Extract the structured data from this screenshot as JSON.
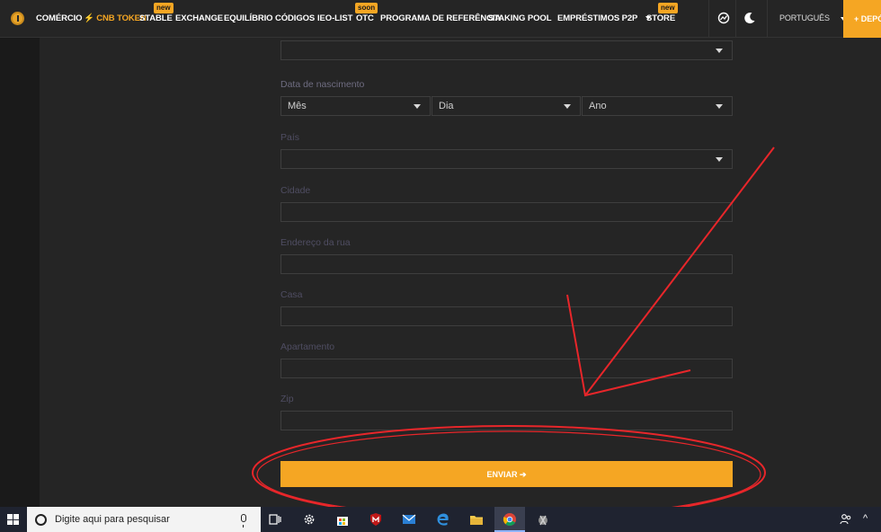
{
  "nav": {
    "items": [
      {
        "label": "COMÉRCIO"
      },
      {
        "label": "⚡ CNB TOKEN"
      },
      {
        "label": "STABLE",
        "badge": "new"
      },
      {
        "label": "EXCHANGE"
      },
      {
        "label": "EQUILÍBRIO"
      },
      {
        "label": "CÓDIGOS"
      },
      {
        "label": "IEO-LIST"
      },
      {
        "label": "OTC",
        "badge": "soon"
      },
      {
        "label": "PROGRAMA DE REFERÊNCIA"
      },
      {
        "label": "STAKING POOL"
      },
      {
        "label": "EMPRÉSTIMOS P2P"
      },
      {
        "label": "STORE",
        "badge": "new"
      }
    ],
    "language": "PORTUGUÊS",
    "deposit": "+ DEPÓ"
  },
  "form": {
    "birthdate_label": "Data de nascimento",
    "month_placeholder": "Mês",
    "day_placeholder": "Dia",
    "year_placeholder": "Ano",
    "country_label": "País",
    "city_label": "Cidade",
    "street_label": "Endereço da rua",
    "house_label": "Casa",
    "apartment_label": "Apartamento",
    "zip_label": "Zip",
    "submit_label": "ENVIAR ➔"
  },
  "taskbar": {
    "search_placeholder": "Digite aqui para pesquisar"
  },
  "colors": {
    "accent": "#f5a623",
    "annotation": "#e8262a",
    "background": "#252525"
  },
  "annotations": {
    "arrow": "red-arrow",
    "ellipse": "red-ellipse-around-submit"
  }
}
